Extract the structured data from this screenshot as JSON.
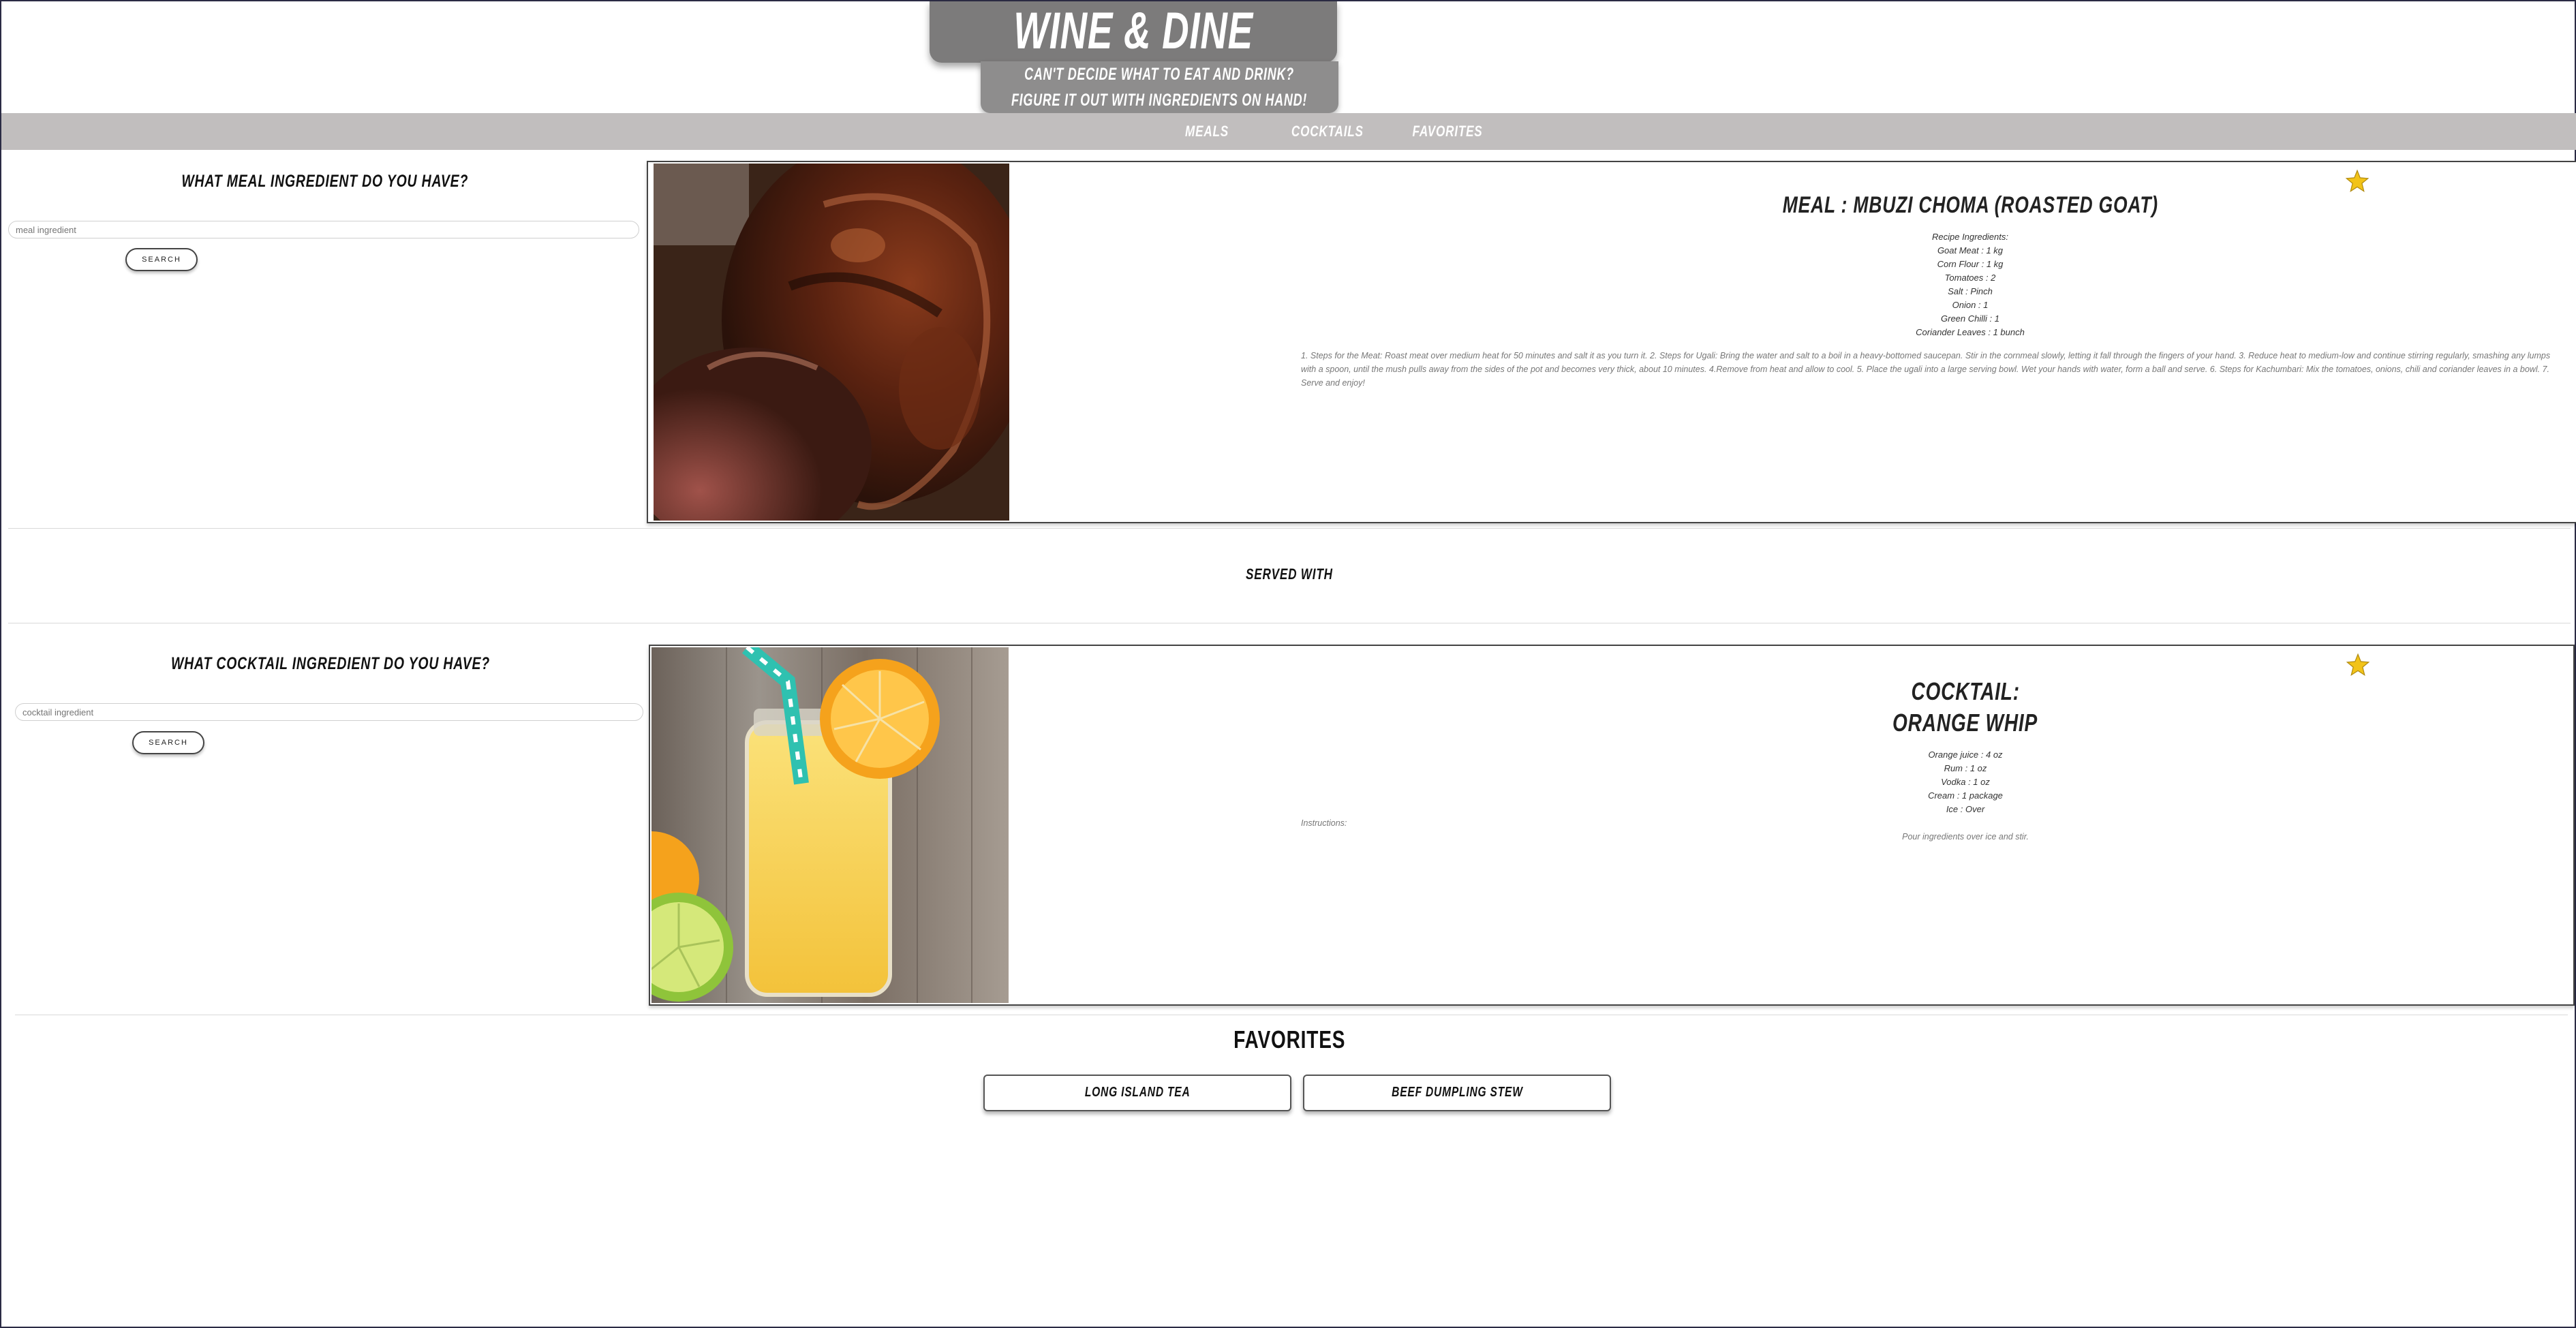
{
  "header": {
    "title": "WINE & DINE",
    "subtitle": "CAN'T DECIDE WHAT TO EAT AND DRINK? FIGURE IT OUT WITH INGREDIENTS ON HAND!"
  },
  "nav": {
    "items": [
      {
        "label": "MEALS"
      },
      {
        "label": "COCKTAILS"
      },
      {
        "label": "FAVORITES"
      }
    ]
  },
  "meal_search": {
    "heading": "WHAT MEAL INGREDIENT DO YOU HAVE?",
    "placeholder": "meal ingredient",
    "button": "SEARCH"
  },
  "meal_card": {
    "title": "MEAL : MBUZI CHOMA (ROASTED GOAT)",
    "ingredients_label": "Recipe Ingredients:",
    "ingredients": [
      "Goat Meat : 1 kg",
      "Corn Flour : 1 kg",
      "Tomatoes : 2",
      "Salt : Pinch",
      "Onion : 1",
      "Green Chilli : 1",
      "Coriander Leaves : 1 bunch"
    ],
    "instructions": "1. Steps for the Meat: Roast meat over medium heat for 50 minutes and salt it as you turn it. 2. Steps for Ugali: Bring the water and salt to a boil in a heavy-bottomed saucepan. Stir in the cornmeal slowly, letting it fall through the fingers of your hand. 3. Reduce heat to medium-low and continue stirring regularly, smashing any lumps with a spoon, until the mush pulls away from the sides of the pot and becomes very thick, about 10 minutes. 4.Remove from heat and allow to cool. 5. Place the ugali into a large serving bowl. Wet your hands with water, form a ball and serve. 6. Steps for Kachumbari: Mix the tomatoes, onions, chili and coriander leaves in a bowl. 7. Serve and enjoy!"
  },
  "served_with": "SERVED WITH",
  "cocktail_search": {
    "heading": "WHAT COCKTAIL INGREDIENT DO YOU HAVE?",
    "placeholder": "cocktail ingredient",
    "button": "SEARCH"
  },
  "cocktail_card": {
    "title_line1": "COCKTAIL:",
    "title_line2": "ORANGE WHIP",
    "ingredients": [
      "Orange juice : 4 oz",
      "Rum : 1 oz",
      "Vodka : 1 oz",
      "Cream : 1 package",
      "Ice : Over"
    ],
    "instructions_label": "Instructions:",
    "instructions": "Pour ingredients over ice and stir."
  },
  "favorites": {
    "heading": "FAVORITES",
    "items": [
      {
        "label": "LONG ISLAND TEA"
      },
      {
        "label": "BEEF DUMPLING STEW"
      }
    ]
  },
  "colors": {
    "header_dark": "#7c7b7b",
    "header_light": "#8e8d8d",
    "navbar": "#c1bebe",
    "star": "#f2c318"
  },
  "icons": {
    "favorite": "star-icon"
  }
}
